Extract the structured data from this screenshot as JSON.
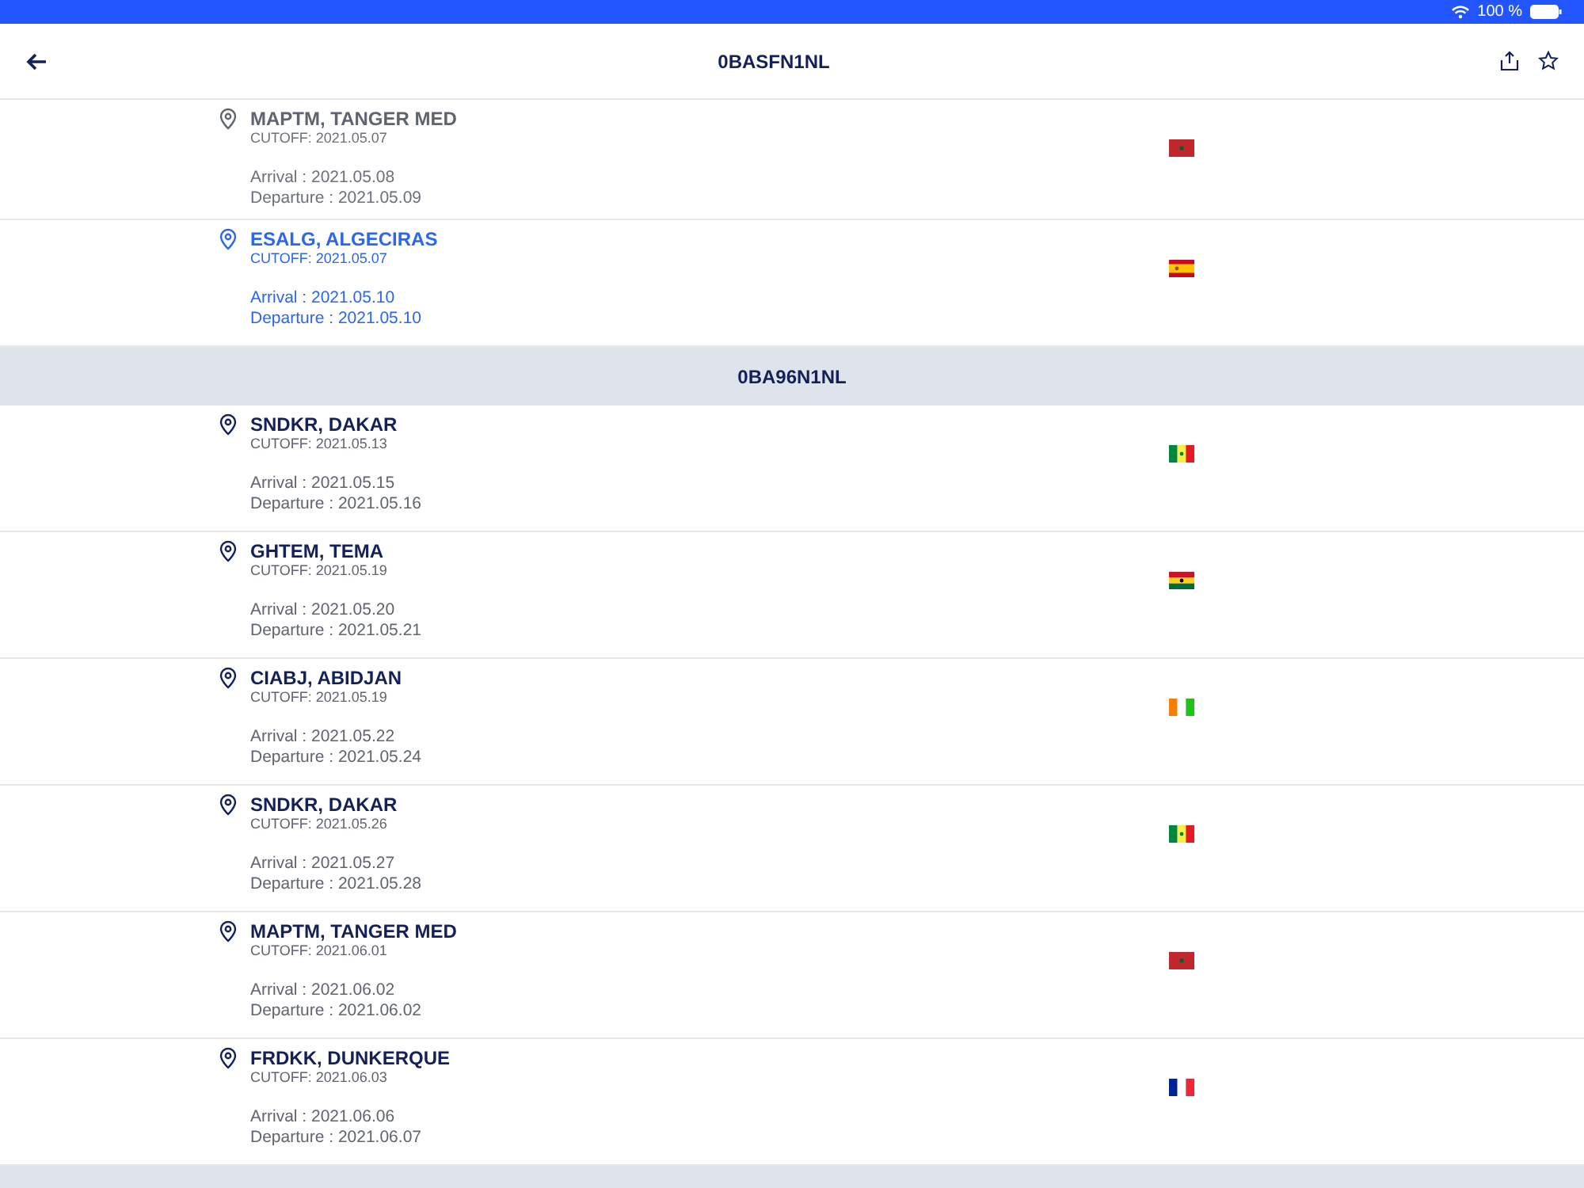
{
  "status_bar": {
    "battery": "100 %"
  },
  "header": {
    "title": "0BASFN1NL"
  },
  "sections": [
    {
      "stops": [
        {
          "name": "MAPTM, TANGER MED",
          "cutoff": "CUTOFF: 2021.05.07",
          "arrival": "Arrival : 2021.05.08",
          "departure": "Departure : 2021.05.09",
          "kind": "past",
          "flag": {
            "kind": "MA"
          }
        },
        {
          "name": "ESALG, ALGECIRAS",
          "cutoff": "CUTOFF: 2021.05.07",
          "arrival": "Arrival : 2021.05.10",
          "departure": "Departure : 2021.05.10",
          "kind": "current",
          "flag": {
            "kind": "ES"
          }
        }
      ]
    },
    {
      "title": "0BA96N1NL",
      "stops": [
        {
          "name": "SNDKR, DAKAR",
          "cutoff": "CUTOFF: 2021.05.13",
          "arrival": "Arrival : 2021.05.15",
          "departure": "Departure : 2021.05.16",
          "kind": "upcoming",
          "flag": {
            "kind": "SN"
          }
        },
        {
          "name": "GHTEM, TEMA",
          "cutoff": "CUTOFF: 2021.05.19",
          "arrival": "Arrival : 2021.05.20",
          "departure": "Departure : 2021.05.21",
          "kind": "upcoming",
          "flag": {
            "kind": "GH"
          }
        },
        {
          "name": "CIABJ, ABIDJAN",
          "cutoff": "CUTOFF: 2021.05.19",
          "arrival": "Arrival : 2021.05.22",
          "departure": "Departure : 2021.05.24",
          "kind": "upcoming",
          "flag": {
            "kind": "CI"
          }
        },
        {
          "name": "SNDKR, DAKAR",
          "cutoff": "CUTOFF: 2021.05.26",
          "arrival": "Arrival : 2021.05.27",
          "departure": "Departure : 2021.05.28",
          "kind": "upcoming",
          "flag": {
            "kind": "SN"
          }
        },
        {
          "name": "MAPTM, TANGER MED",
          "cutoff": "CUTOFF: 2021.06.01",
          "arrival": "Arrival : 2021.06.02",
          "departure": "Departure : 2021.06.02",
          "kind": "upcoming",
          "flag": {
            "kind": "MA"
          }
        },
        {
          "name": "FRDKK, DUNKERQUE",
          "cutoff": "CUTOFF: 2021.06.03",
          "arrival": "Arrival : 2021.06.06",
          "departure": "Departure : 2021.06.07",
          "kind": "upcoming",
          "flag": {
            "kind": "FR"
          }
        }
      ]
    }
  ],
  "more_below": true
}
